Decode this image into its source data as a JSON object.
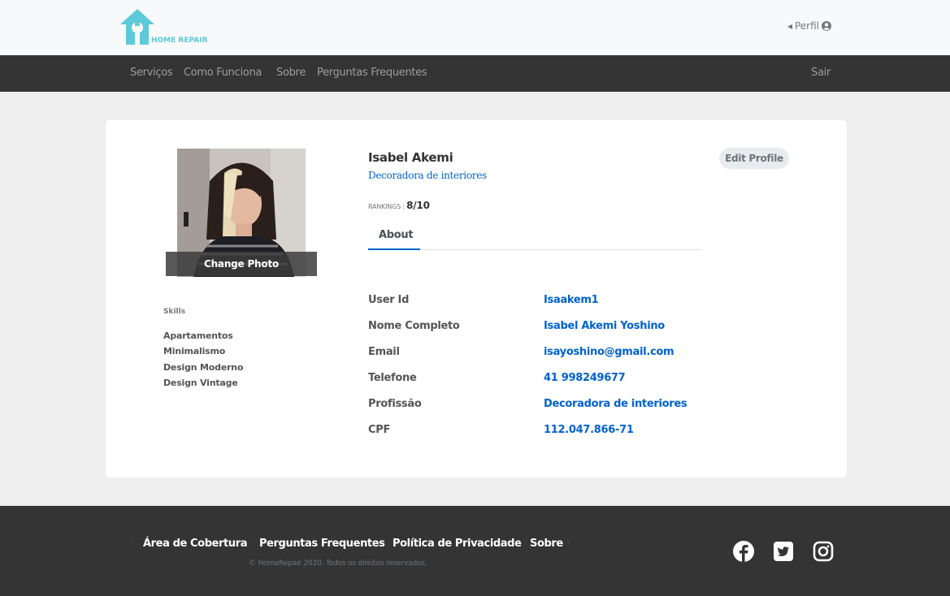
{
  "header": {
    "logo_text": "HOME REPAIR",
    "perfil_label": "Perfil"
  },
  "nav": {
    "items": [
      "Serviços",
      "Como Funciona",
      "Sobre",
      "Perguntas Frequentes"
    ],
    "logout": "Sair"
  },
  "profile": {
    "change_photo": "Change Photo",
    "skills_title": "Skills",
    "skills": [
      "Apartamentos",
      "Minimalismo",
      "Design Moderno",
      "Design Vintage"
    ],
    "name": "Isabel Akemi",
    "profession": "Decoradora de interiores",
    "rankings_label": "RANKINGS :",
    "rankings_value": "8/10",
    "edit_button": "Edit Profile",
    "tab_about": "About",
    "fields": [
      {
        "label": "User Id",
        "value": "Isaakem1"
      },
      {
        "label": "Nome Completo",
        "value": "Isabel Akemi Yoshino"
      },
      {
        "label": "Email",
        "value": "isayoshino@gmail.com"
      },
      {
        "label": "Telefone",
        "value": "41 998249677"
      },
      {
        "label": "Profissão",
        "value": "Decoradora de interiores"
      },
      {
        "label": "CPF",
        "value": "112.047.866-71"
      }
    ]
  },
  "footer": {
    "links": [
      "Área de Cobertura",
      "Perguntas Frequentes",
      "Política de Privacidade",
      "Sobre"
    ],
    "copyright": "© HomeRepair 2020. Todos os direitos reservados.",
    "social": [
      "facebook-icon",
      "twitter-icon",
      "instagram-icon"
    ]
  },
  "colors": {
    "accent": "#0062cc",
    "logo": "#5ccad8",
    "nav_bg": "#343434",
    "page_bg": "#eeeeee"
  }
}
